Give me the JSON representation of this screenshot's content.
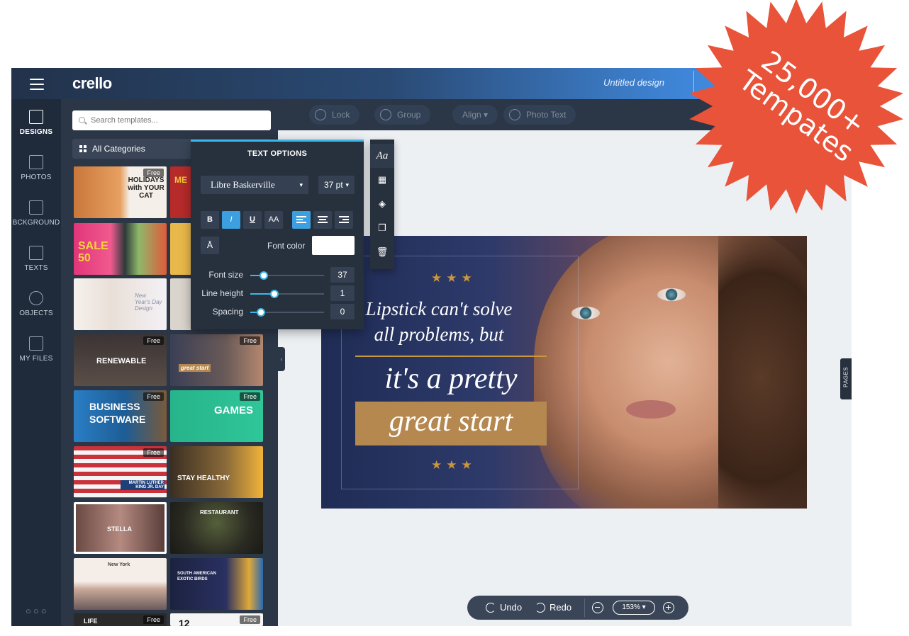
{
  "header": {
    "logo": "crello",
    "document_title": "Untitled design"
  },
  "rail": {
    "items": [
      {
        "label": "DESIGNS",
        "icon": "designs-icon"
      },
      {
        "label": "PHOTOS",
        "icon": "photos-icon"
      },
      {
        "label": "BCKGROUND",
        "icon": "background-icon"
      },
      {
        "label": "TEXTS",
        "icon": "texts-icon"
      },
      {
        "label": "OBJECTS",
        "icon": "objects-icon"
      },
      {
        "label": "MY FILES",
        "icon": "my-files-icon"
      }
    ],
    "more": "○○○"
  },
  "templates": {
    "search_placeholder": "Search templates...",
    "category": "All Categories",
    "free_badge": "Free",
    "thumbs": [
      {
        "title": "HOLIDAYS with YOUR CAT"
      },
      {
        "title": "ME"
      },
      {
        "title": "SALE 50"
      },
      {
        "title": ""
      },
      {
        "title": "New Year's Day Design"
      },
      {
        "title": ""
      },
      {
        "title": "RENEWABLE"
      },
      {
        "title": "great start"
      },
      {
        "title": "BUSINESS SOFTWARE"
      },
      {
        "title": "GAMES"
      },
      {
        "title": "MARTIN LUTHER KING JR. DAY"
      },
      {
        "title": "STAY HEALTHY"
      },
      {
        "title": "STELLA"
      },
      {
        "title": "RESTAURANT"
      },
      {
        "title": "New York"
      },
      {
        "title": "SOUTH AMERICAN EXOTIC BIRDS"
      },
      {
        "title": "LIFE"
      },
      {
        "title": "12"
      }
    ]
  },
  "toolbar": {
    "lock": "Lock",
    "group": "Group",
    "align": "Align ▾",
    "photo_text": "Photo Text"
  },
  "text_options": {
    "title": "TEXT OPTIONS",
    "font": "Libre Baskerville",
    "size": "37 pt",
    "bold": "B",
    "italic": "I",
    "underline": "U",
    "caps": "AA",
    "caps_toggle": "Ā",
    "font_color_label": "Font color",
    "font_color": "#ffffff",
    "font_size_label": "Font size",
    "font_size_value": "37",
    "font_size_level": 0.18,
    "line_height_label": "Line height",
    "line_height_value": "1",
    "line_height_level": 0.33,
    "spacing_label": "Spacing",
    "spacing_value": "0",
    "spacing_level": 0.14
  },
  "side_tools": {
    "text_style": "Aa"
  },
  "design": {
    "stars": "★★★",
    "line1": "Lipstick can't solve",
    "line2": "all problems, but",
    "line3": "it's a pretty",
    "line4": "great start",
    "accent": "#c9973e"
  },
  "pages_tab": "PAGES",
  "bottom": {
    "undo": "Undo",
    "redo": "Redo",
    "zoom": "153% ▾"
  },
  "promo": {
    "number": "25,000+",
    "word": "Tempates",
    "color": "#e8533a"
  }
}
